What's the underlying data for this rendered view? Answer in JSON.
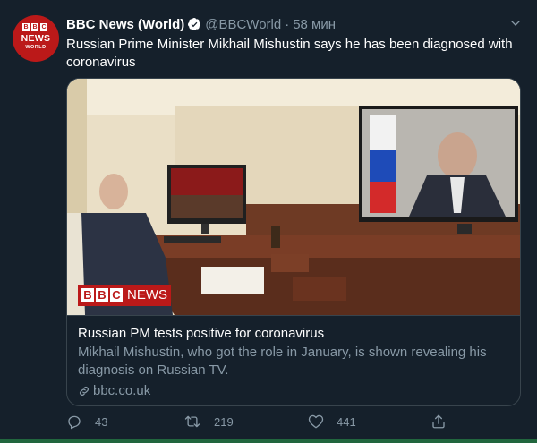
{
  "account": {
    "display_name": "BBC News (World)",
    "handle": "@BBCWorld",
    "separator": "·",
    "time": "58 мин",
    "avatar": {
      "bbc_letters": [
        "B",
        "B",
        "C"
      ],
      "line1": "NEWS",
      "line2": "WORLD"
    }
  },
  "tweet": {
    "text": "Russian Prime Minister Mikhail Mishustin says he has been diagnosed with coronavirus"
  },
  "card": {
    "image_badge": {
      "bbc_letters": [
        "B",
        "B",
        "C"
      ],
      "news": "NEWS"
    },
    "title": "Russian PM tests positive for coronavirus",
    "description": "Mikhail Mishustin, who got the role in January, is shown revealing his diagnosis on Russian TV.",
    "domain": "bbc.co.uk"
  },
  "actions": {
    "replies": "43",
    "retweets": "219",
    "likes": "441"
  },
  "colors": {
    "background": "#15202b",
    "text_primary": "#ffffff",
    "text_secondary": "#8899a6",
    "border": "#38444d",
    "bbc_red": "#bb1919",
    "verified_blue": "#1da1f2"
  },
  "icons": [
    "verified-badge-icon",
    "chevron-down-icon",
    "link-icon",
    "reply-icon",
    "retweet-icon",
    "like-icon",
    "share-icon"
  ]
}
